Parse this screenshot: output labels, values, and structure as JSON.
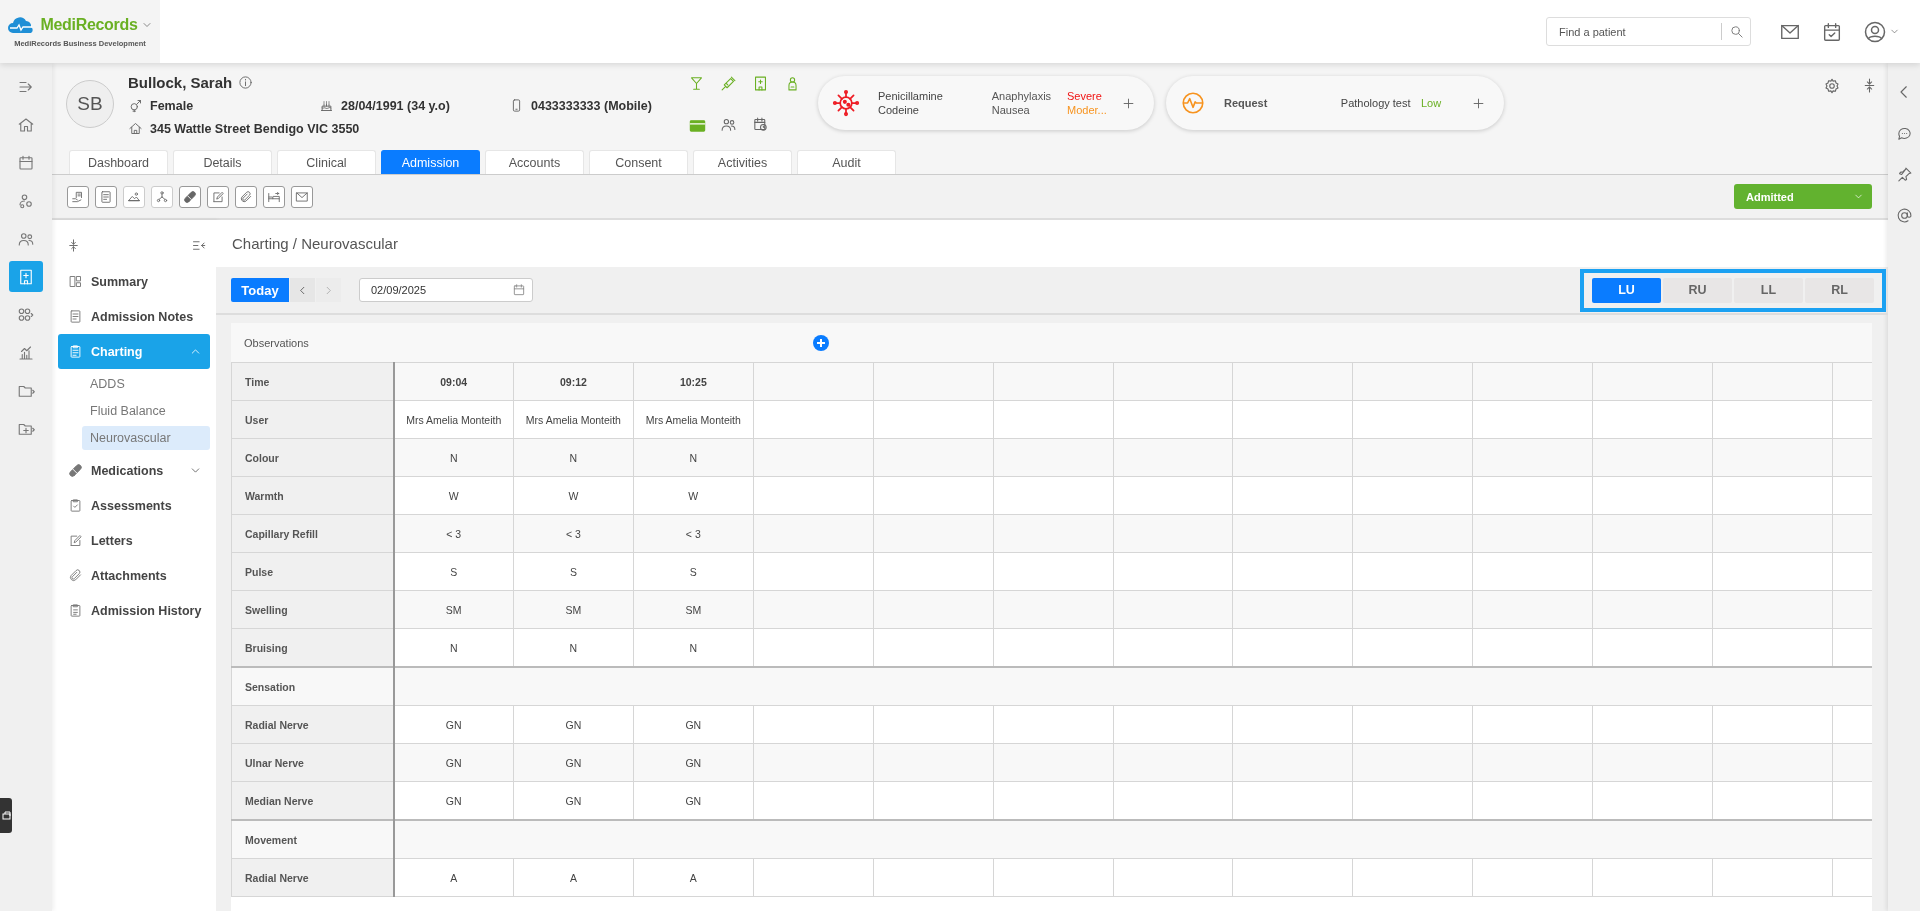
{
  "brand": {
    "name": "MediRecords",
    "subtitle": "MediRecords Business Development"
  },
  "search": {
    "placeholder": "Find a patient"
  },
  "nav_rail": [
    {
      "selected": false
    },
    {
      "selected": false
    },
    {
      "selected": false
    },
    {
      "selected": false
    },
    {
      "selected": false
    },
    {
      "selected": true
    },
    {
      "selected": false
    },
    {
      "selected": false
    },
    {
      "selected": false
    },
    {
      "selected": false
    }
  ],
  "patient": {
    "initials": "SB",
    "name": "Bullock, Sarah",
    "gender": "Female",
    "dob": "28/04/1991 (34 y.o)",
    "phone": "0433333333 (Mobile)",
    "address": "345 Wattle Street Bendigo VIC 3550"
  },
  "alerts": [
    {
      "substance": "Penicillamine",
      "reaction": "Anaphylaxis",
      "severity": "Severe",
      "color": "#f01414"
    },
    {
      "substance": "Codeine",
      "reaction": "Nausea",
      "severity": "Moder...",
      "color": "#f7931e"
    }
  ],
  "request": {
    "label": "Request",
    "test": "Pathology test",
    "priority": "Low"
  },
  "tabs": [
    {
      "label": "Dashboard",
      "selected": false
    },
    {
      "label": "Details",
      "selected": false
    },
    {
      "label": "Clinical",
      "selected": false
    },
    {
      "label": "Admission",
      "selected": true
    },
    {
      "label": "Accounts",
      "selected": false
    },
    {
      "label": "Consent",
      "selected": false
    },
    {
      "label": "Activities",
      "selected": false
    },
    {
      "label": "Audit",
      "selected": false
    }
  ],
  "toolbar": [
    {
      "disabled": false
    },
    {
      "disabled": false
    },
    {
      "disabled": true
    },
    {
      "disabled": true
    },
    {
      "disabled": false
    },
    {
      "disabled": false
    },
    {
      "disabled": false
    },
    {
      "disabled": false
    },
    {
      "disabled": false
    }
  ],
  "status": {
    "label": "Admitted"
  },
  "sidebar": [
    {
      "label": "Summary",
      "selected": false
    },
    {
      "label": "Admission Notes",
      "selected": false
    },
    {
      "label": "Charting",
      "selected": true,
      "expanded": true,
      "children": [
        {
          "label": "ADDS",
          "selected": false
        },
        {
          "label": "Fluid Balance",
          "selected": false
        },
        {
          "label": "Neurovascular",
          "selected": true
        }
      ]
    },
    {
      "label": "Medications",
      "selected": false,
      "expanded": false
    },
    {
      "label": "Assessments",
      "selected": false
    },
    {
      "label": "Letters",
      "selected": false
    },
    {
      "label": "Attachments",
      "selected": false
    },
    {
      "label": "Admission History",
      "selected": false
    }
  ],
  "breadcrumb": "Charting / Neurovascular",
  "date_nav": {
    "today": "Today",
    "date": "02/09/2025"
  },
  "limbs": [
    {
      "label": "LU",
      "selected": true
    },
    {
      "label": "RU",
      "selected": false
    },
    {
      "label": "LL",
      "selected": false
    },
    {
      "label": "RL",
      "selected": false
    }
  ],
  "observations": {
    "title": "Observations",
    "rows": [
      {
        "kind": "time",
        "label": "Time",
        "values": [
          "09:04",
          "09:12",
          "10:25"
        ]
      },
      {
        "kind": "data",
        "label": "User",
        "values": [
          "Mrs Amelia Monteith",
          "Mrs Amelia Monteith",
          "Mrs Amelia Monteith"
        ]
      },
      {
        "kind": "data",
        "label": "Colour",
        "values": [
          "N",
          "N",
          "N"
        ]
      },
      {
        "kind": "data",
        "label": "Warmth",
        "values": [
          "W",
          "W",
          "W"
        ]
      },
      {
        "kind": "data",
        "label": "Capillary Refill",
        "values": [
          "< 3",
          "< 3",
          "< 3"
        ]
      },
      {
        "kind": "data",
        "label": "Pulse",
        "values": [
          "S",
          "S",
          "S"
        ]
      },
      {
        "kind": "data",
        "label": "Swelling",
        "values": [
          "SM",
          "SM",
          "SM"
        ]
      },
      {
        "kind": "data",
        "label": "Bruising",
        "values": [
          "N",
          "N",
          "N"
        ]
      },
      {
        "kind": "section",
        "label": "Sensation"
      },
      {
        "kind": "data",
        "label": "Radial Nerve",
        "values": [
          "GN",
          "GN",
          "GN"
        ]
      },
      {
        "kind": "data",
        "label": "Ulnar Nerve",
        "values": [
          "GN",
          "GN",
          "GN"
        ]
      },
      {
        "kind": "data",
        "label": "Median Nerve",
        "values": [
          "GN",
          "GN",
          "GN"
        ]
      },
      {
        "kind": "section",
        "label": "Movement"
      },
      {
        "kind": "data",
        "label": "Radial Nerve",
        "values": [
          "A",
          "A",
          "A"
        ]
      }
    ]
  }
}
